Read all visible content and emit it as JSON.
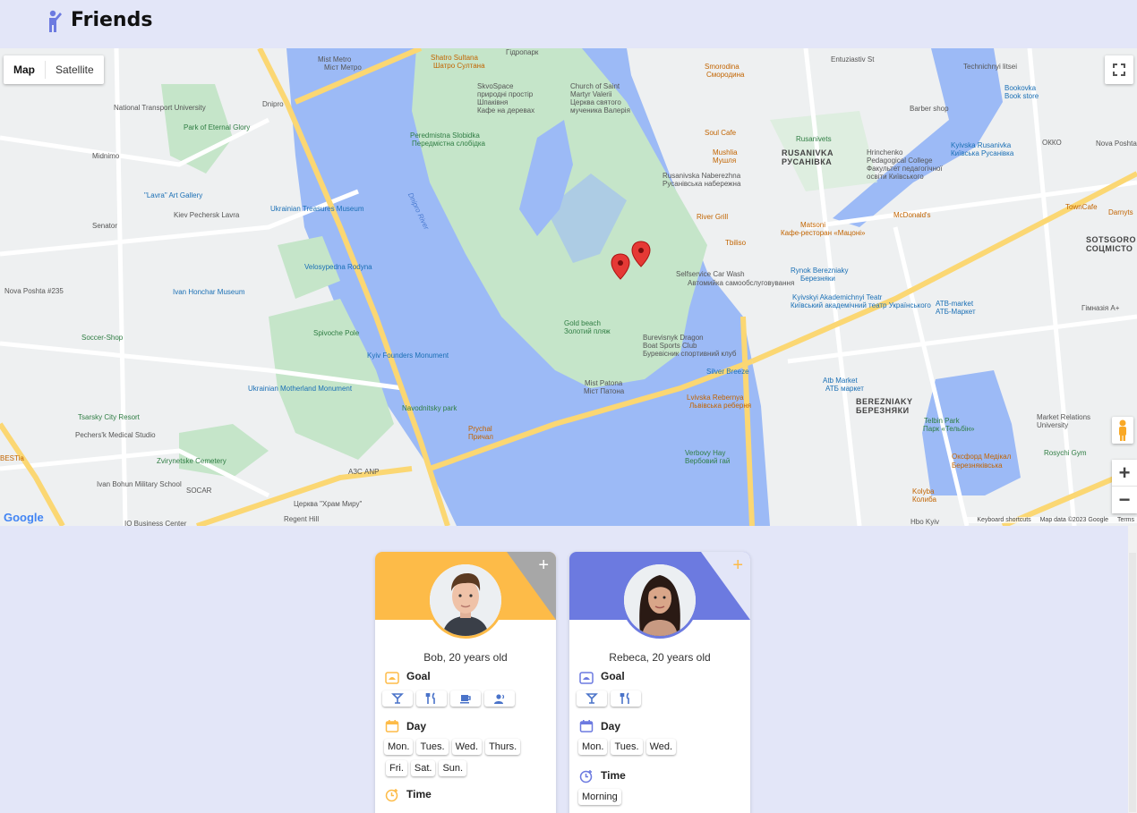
{
  "header": {
    "title": "Friends",
    "logo_icon": "person-waving-icon",
    "accent": "#6c7ae0"
  },
  "map": {
    "toggle": {
      "map_label": "Map",
      "satellite_label": "Satellite",
      "active": "Map"
    },
    "zoom_in": "+",
    "zoom_out": "−",
    "google_logo": "Google",
    "attribution": {
      "shortcuts": "Keyboard shortcuts",
      "data": "Map data ©2023 Google",
      "terms": "Terms"
    },
    "labels": [
      {
        "t": "Mist Metro",
        "c": ""
      },
      {
        "t": "Міст Метро",
        "c": ""
      },
      {
        "t": "Shatro Sultana",
        "c": "orange"
      },
      {
        "t": "Шатро Султана",
        "c": "orange"
      },
      {
        "t": "Гідропарк",
        "c": ""
      },
      {
        "t": "SkvoSpace",
        "c": ""
      },
      {
        "t": "природні простір",
        "c": ""
      },
      {
        "t": "Шпаківня",
        "c": ""
      },
      {
        "t": "Кафе на деревах",
        "c": ""
      },
      {
        "t": "Church of Saint",
        "c": ""
      },
      {
        "t": "Martyr Valerii",
        "c": ""
      },
      {
        "t": "Церква святого",
        "c": ""
      },
      {
        "t": "мученика Валерія",
        "c": ""
      },
      {
        "t": "Smorodina",
        "c": "orange"
      },
      {
        "t": "Смородина",
        "c": "orange"
      },
      {
        "t": "Technichnyi litsei",
        "c": ""
      },
      {
        "t": "Entuziastiv St",
        "c": ""
      },
      {
        "t": "Bookovka",
        "c": "blue"
      },
      {
        "t": "Book store",
        "c": "blue"
      },
      {
        "t": "Barber shop",
        "c": ""
      },
      {
        "t": "Soul Cafe",
        "c": "orange"
      },
      {
        "t": "Mushlia",
        "c": "orange"
      },
      {
        "t": "Мушля",
        "c": "orange"
      },
      {
        "t": "Rusanivets",
        "c": "green"
      },
      {
        "t": "RUSANIVKA",
        "c": "bold"
      },
      {
        "t": "РУСАНІВКА",
        "c": "bold"
      },
      {
        "t": "Hrinchenko",
        "c": ""
      },
      {
        "t": "Pedagogical College",
        "c": ""
      },
      {
        "t": "Факультет педагогічної",
        "c": ""
      },
      {
        "t": "освіти Київського",
        "c": ""
      },
      {
        "t": "Kyivska Rusanivka",
        "c": "blue"
      },
      {
        "t": "Київська Русанівка",
        "c": "blue"
      },
      {
        "t": "ОККО",
        "c": ""
      },
      {
        "t": "Nova Poshta",
        "c": ""
      },
      {
        "t": "Rusanivska Naberezhna",
        "c": ""
      },
      {
        "t": "Русанівська набережна",
        "c": ""
      },
      {
        "t": "River Grill",
        "c": "orange"
      },
      {
        "t": "Tbiliso",
        "c": "orange"
      },
      {
        "t": "Matsoni",
        "c": "orange"
      },
      {
        "t": "Кафе-ресторан «Мацоні»",
        "c": "orange"
      },
      {
        "t": "McDonald's",
        "c": "orange"
      },
      {
        "t": "TownCafe",
        "c": "orange"
      },
      {
        "t": "Darnyts",
        "c": "orange"
      },
      {
        "t": "SOTSGORO",
        "c": "bold"
      },
      {
        "t": "СОЦМІСТО",
        "c": "bold"
      },
      {
        "t": "Selfservice Car Wash",
        "c": ""
      },
      {
        "t": "Автомийка самообслуговування",
        "c": ""
      },
      {
        "t": "Rynok Berezniaky",
        "c": "blue"
      },
      {
        "t": "Березняки",
        "c": "blue"
      },
      {
        "t": "Kyivskyi Akademichnyi Teatr",
        "c": "blue"
      },
      {
        "t": "Київський академічний театр Українського",
        "c": "blue"
      },
      {
        "t": "ATB-market",
        "c": "blue"
      },
      {
        "t": "АТБ-Маркет",
        "c": "blue"
      },
      {
        "t": "Гімназія А+",
        "c": ""
      },
      {
        "t": "Peredmistna Slobidka",
        "c": "green"
      },
      {
        "t": "Передмістна слобідка",
        "c": "green"
      },
      {
        "t": "Gold beach",
        "c": "green"
      },
      {
        "t": "Золотий пляж",
        "c": "green"
      },
      {
        "t": "Burevisnyk Dragon",
        "c": ""
      },
      {
        "t": "Boat Sports Club",
        "c": ""
      },
      {
        "t": "Буревісник спортивний клуб",
        "c": ""
      },
      {
        "t": "Silver Breeze",
        "c": "blue"
      },
      {
        "t": "Mist Patona",
        "c": ""
      },
      {
        "t": "Міст Патона",
        "c": ""
      },
      {
        "t": "Lvivska Rebernya",
        "c": "orange"
      },
      {
        "t": "Львівська реберня",
        "c": "orange"
      },
      {
        "t": "Atb Market",
        "c": "blue"
      },
      {
        "t": "АТБ маркет",
        "c": "blue"
      },
      {
        "t": "BEREZNIAKY",
        "c": "bold"
      },
      {
        "t": "БЕРЕЗНЯКИ",
        "c": "bold"
      },
      {
        "t": "Telbin Park",
        "c": "green"
      },
      {
        "t": "Парк «Тельбін»",
        "c": "green"
      },
      {
        "t": "Market Relations",
        "c": ""
      },
      {
        "t": "University",
        "c": ""
      },
      {
        "t": "Verbovy Hay",
        "c": "green"
      },
      {
        "t": "Вербовий гай",
        "c": "green"
      },
      {
        "t": "Оксфорд Медікал",
        "c": "orange"
      },
      {
        "t": "Березняківська",
        "c": "orange"
      },
      {
        "t": "Rosychi Gym",
        "c": "green"
      },
      {
        "t": "Kolyba",
        "c": "orange"
      },
      {
        "t": "Колиба",
        "c": "orange"
      },
      {
        "t": "Hbo Kyiv",
        "c": ""
      },
      {
        "t": "Dnipro River",
        "c": "water"
      },
      {
        "t": "Prychal",
        "c": "orange"
      },
      {
        "t": "Причал",
        "c": "orange"
      },
      {
        "t": "Navodnitsky park",
        "c": "green"
      },
      {
        "t": "Kyiv Founders Monument",
        "c": "blue"
      },
      {
        "t": "Ukrainian Motherland Monument",
        "c": "blue"
      },
      {
        "t": "Spivoche Pole",
        "c": "green"
      },
      {
        "t": "Velosypedna Rodyna",
        "c": "blue"
      },
      {
        "t": "Ivan Honchar Museum",
        "c": "blue"
      },
      {
        "t": "Ukrainian Treasures Museum",
        "c": "blue"
      },
      {
        "t": "Kiev Pechersk Lavra",
        "c": ""
      },
      {
        "t": "\"Lavra\" Art Gallery",
        "c": "blue"
      },
      {
        "t": "Park of Eternal Glory",
        "c": "green"
      },
      {
        "t": "National Transport University",
        "c": ""
      },
      {
        "t": "Midnimo",
        "c": ""
      },
      {
        "t": "Senator",
        "c": ""
      },
      {
        "t": "Nova Poshta #235",
        "c": ""
      },
      {
        "t": "Soccer-Shop",
        "c": "green"
      },
      {
        "t": "Tsarsky City Resort",
        "c": "green"
      },
      {
        "t": "Pechers'k Medical Studio",
        "c": ""
      },
      {
        "t": "Zvirynetske Cemetery",
        "c": "green"
      },
      {
        "t": "Ivan Bohun Military School",
        "c": ""
      },
      {
        "t": "BESTia",
        "c": "orange"
      },
      {
        "t": "SOCAR",
        "c": ""
      },
      {
        "t": "АЗС ANP",
        "c": ""
      },
      {
        "t": "Церква \"Храм Миру\"",
        "c": ""
      },
      {
        "t": "Regent Hill",
        "c": ""
      },
      {
        "t": "IQ Business Center",
        "c": ""
      },
      {
        "t": "Dnipro",
        "c": ""
      }
    ]
  },
  "friends": [
    {
      "name": "Bob, 20 years old",
      "banner_color": "#fdbb48",
      "plus_color": "#ffffff",
      "avatar_color": "#fdbb48",
      "avatar": "male-avatar",
      "goal_title": "Goal",
      "goal_icons": [
        "cocktail-icon",
        "food-icon",
        "coffee-icon",
        "talk-icon"
      ],
      "day_title": "Day",
      "days": [
        "Mon.",
        "Tues.",
        "Wed.",
        "Thurs.",
        "Fri.",
        "Sat.",
        "Sun."
      ],
      "time_title": "Time"
    },
    {
      "name": "Rebeca, 20 years old",
      "banner_color": "#6c7ae0",
      "plus_color": "#fdbb48",
      "avatar_color": "#6c7ae0",
      "avatar": "female-avatar",
      "goal_title": "Goal",
      "goal_icons": [
        "cocktail-icon",
        "food-icon"
      ],
      "day_title": "Day",
      "days": [
        "Mon.",
        "Tues.",
        "Wed."
      ],
      "time_title": "Time",
      "times": [
        "Morning"
      ]
    }
  ]
}
